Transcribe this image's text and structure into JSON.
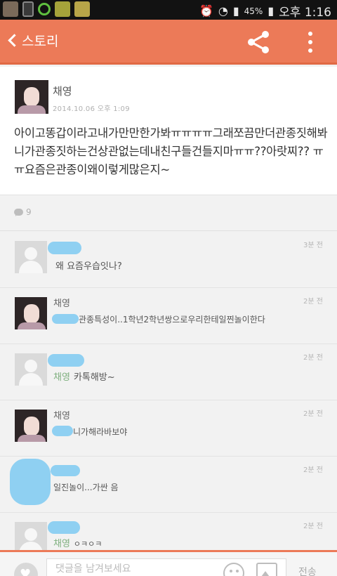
{
  "status": {
    "battery": "45%",
    "time": "오후 1:16"
  },
  "app_bar": {
    "back_label": "스토리"
  },
  "post": {
    "author": "채영",
    "date": "2014.10.06 오후 1:09",
    "body": "아이고똥갑이라고내가만만한가봐ㅠㅠㅠㅠ그래쪼끔만더관종짓해봐니가관종짓하는건상관없는데내친구들건들지마ㅠㅠ??아랏찌?? ㅠㅠ요즘은관종이왜이렇게많은지~"
  },
  "comment_count": "9",
  "comments": [
    {
      "name": "",
      "time": "3분 전",
      "mention": "",
      "text": "왜 요즘우습잇나?",
      "avatar": "default"
    },
    {
      "name": "채영",
      "time": "2분 전",
      "mention": "",
      "text": "관종특성이..1학년2학년쌍으로우리한테일찐놀이한다",
      "avatar": "photo"
    },
    {
      "name": "",
      "time": "2분 전",
      "mention": "채영",
      "text": "카톡해방~",
      "avatar": "default"
    },
    {
      "name": "채영",
      "time": "2분 전",
      "mention": "",
      "text": "니가해라바보야",
      "avatar": "photo"
    },
    {
      "name": "",
      "time": "2분 전",
      "mention": "",
      "text": "일진놀이...가싼 음",
      "avatar": "hidden"
    },
    {
      "name": "",
      "time": "2분 전",
      "mention": "채영",
      "text": "ㅇㅋㅇㅋ",
      "avatar": "default"
    }
  ],
  "input": {
    "placeholder": "댓글을 남겨보세요",
    "send_label": "전송"
  },
  "colors": {
    "accent": "#ec7a58",
    "mention": "#7fb07f",
    "redaction": "#8fd0f2"
  },
  "icons": [
    "back-chevron-icon",
    "share-icon",
    "more-vert-icon",
    "comment-bubble-icon",
    "heart-icon",
    "emoji-icon",
    "photo-icon"
  ]
}
